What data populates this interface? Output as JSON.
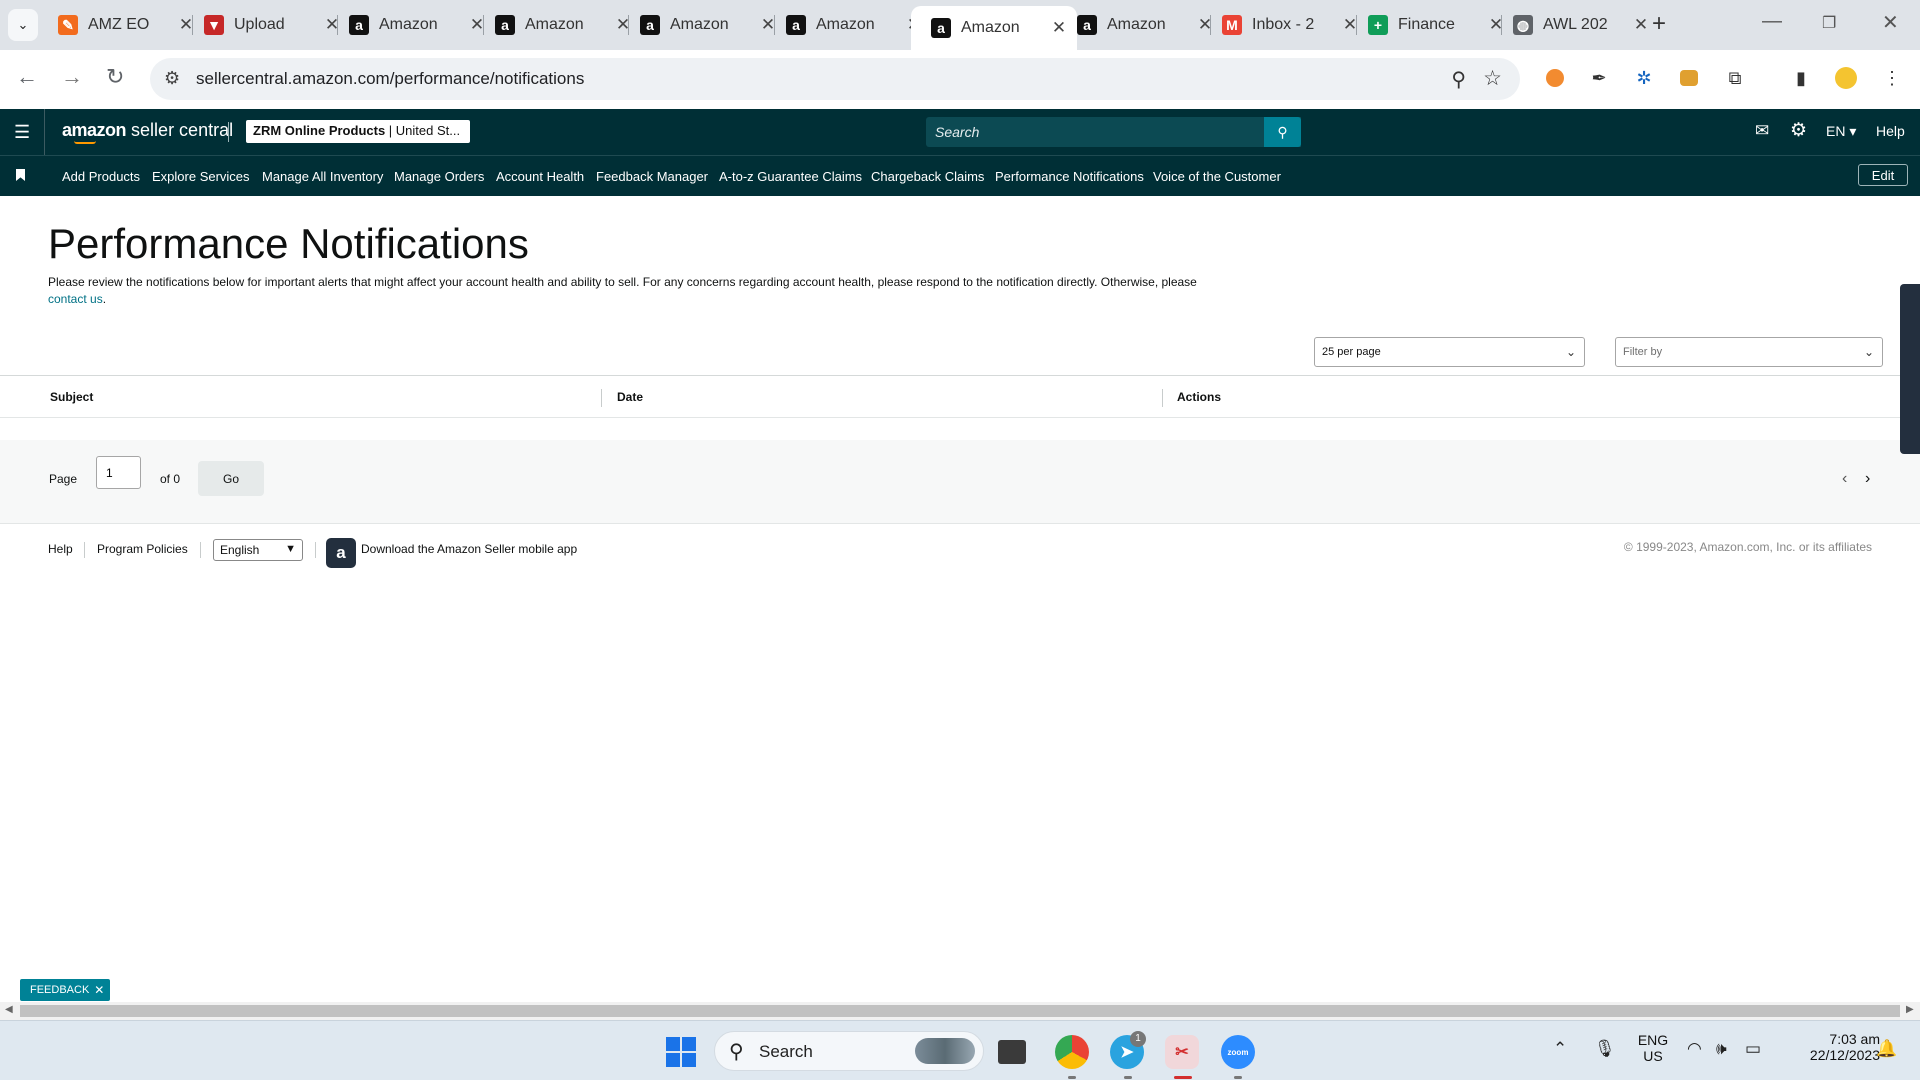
{
  "browser": {
    "tabs": [
      {
        "title": "AMZ EO",
        "favicon_color": "#f26b1d",
        "glyph": "✎"
      },
      {
        "title": "Upload",
        "favicon_color": "#c62828",
        "glyph": "▼"
      },
      {
        "title": "Amazon",
        "favicon_color": "#111111",
        "glyph": "a"
      },
      {
        "title": "Amazon",
        "favicon_color": "#111111",
        "glyph": "a"
      },
      {
        "title": "Amazon",
        "favicon_color": "#111111",
        "glyph": "a"
      },
      {
        "title": "Amazon",
        "favicon_color": "#111111",
        "glyph": "a"
      },
      {
        "title": "Amazon",
        "favicon_color": "#111111",
        "glyph": "a",
        "active": true
      },
      {
        "title": "Amazon",
        "favicon_color": "#111111",
        "glyph": "a"
      },
      {
        "title": "Inbox - 2",
        "favicon_color": "#ea4335",
        "glyph": "M"
      },
      {
        "title": "Finance",
        "favicon_color": "#0f9d58",
        "glyph": "+"
      },
      {
        "title": "AWL 202",
        "favicon_color": "#5f6368",
        "glyph": "◍"
      }
    ],
    "url": "sellercentral.amazon.com/performance/notifications"
  },
  "header": {
    "logo_brand": "amazon",
    "logo_suffix": "seller central",
    "account_name": "ZRM Online Products",
    "account_region": "United St...",
    "search_placeholder": "Search",
    "language": "EN",
    "help": "Help"
  },
  "nav": {
    "items": [
      "Add Products",
      "Explore Services",
      "Manage All Inventory",
      "Manage Orders",
      "Account Health",
      "Feedback Manager",
      "A-to-z Guarantee Claims",
      "Chargeback Claims",
      "Performance Notifications",
      "Voice of the Customer"
    ],
    "edit_label": "Edit"
  },
  "page": {
    "title": "Performance Notifications",
    "intro_text": "Please review the notifications below for important alerts that might affect your account health and ability to sell. For any concerns regarding account health, please respond to the notification directly. Otherwise, please",
    "intro_link": "contact us",
    "per_page": "25 per page",
    "filter_placeholder": "Filter by",
    "columns": [
      "Subject",
      "Date",
      "Actions"
    ]
  },
  "pager": {
    "page_label": "Page",
    "current_page": "1",
    "of_label": "of 0",
    "go_label": "Go"
  },
  "footer": {
    "help": "Help",
    "program_policies": "Program Policies",
    "language": "English",
    "app_text": "Download the Amazon Seller mobile app",
    "copyright": "© 1999-2023, Amazon.com, Inc. or its affiliates"
  },
  "feedback_label": "FEEDBACK",
  "taskbar": {
    "search_label": "Search",
    "lang_line1": "ENG",
    "lang_line2": "US",
    "time": "7:03 am",
    "date": "22/12/2023",
    "telegram_badge": "1"
  }
}
